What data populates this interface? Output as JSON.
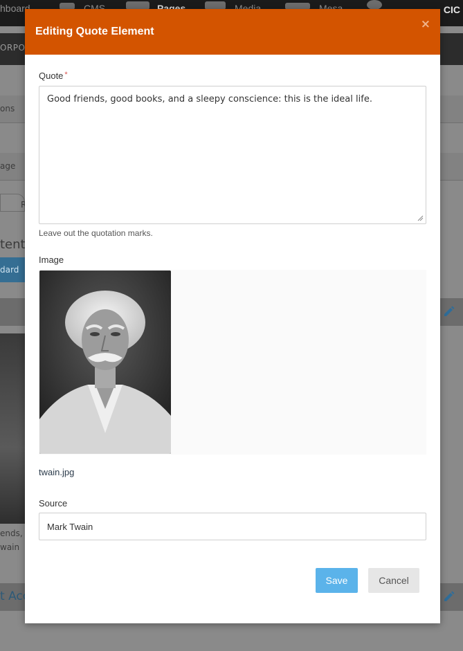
{
  "app": {
    "nav_items": [
      "hboard",
      "CMS",
      "Pages",
      "Media",
      "Mesa"
    ],
    "active_nav": "Pages",
    "brand": "CIC",
    "subnav_label": "ORPOR",
    "bg_texts": {
      "actions": "ons",
      "page": "age",
      "tab": "R",
      "content_heading": "tent",
      "standard_button": "dard",
      "quote_preview_1": "ends, g",
      "quote_preview_2": "wain",
      "next_section": "t Acc"
    }
  },
  "modal": {
    "title": "Editing Quote Element",
    "close_symbol": "×",
    "quote": {
      "label": "Quote",
      "required_mark": "*",
      "value": "Good friends, good books, and a sleepy conscience: this is the ideal life.",
      "help": "Leave out the quotation marks."
    },
    "image": {
      "label": "Image",
      "filename": "twain.jpg"
    },
    "source": {
      "label": "Source",
      "value": "Mark Twain"
    },
    "buttons": {
      "save": "Save",
      "cancel": "Cancel"
    }
  },
  "colors": {
    "header": "#d35400",
    "save": "#5bb3ea",
    "cancel": "#e6e6e6"
  },
  "icons": [
    "close-icon",
    "pencil-icon",
    "resize-grip-icon"
  ]
}
